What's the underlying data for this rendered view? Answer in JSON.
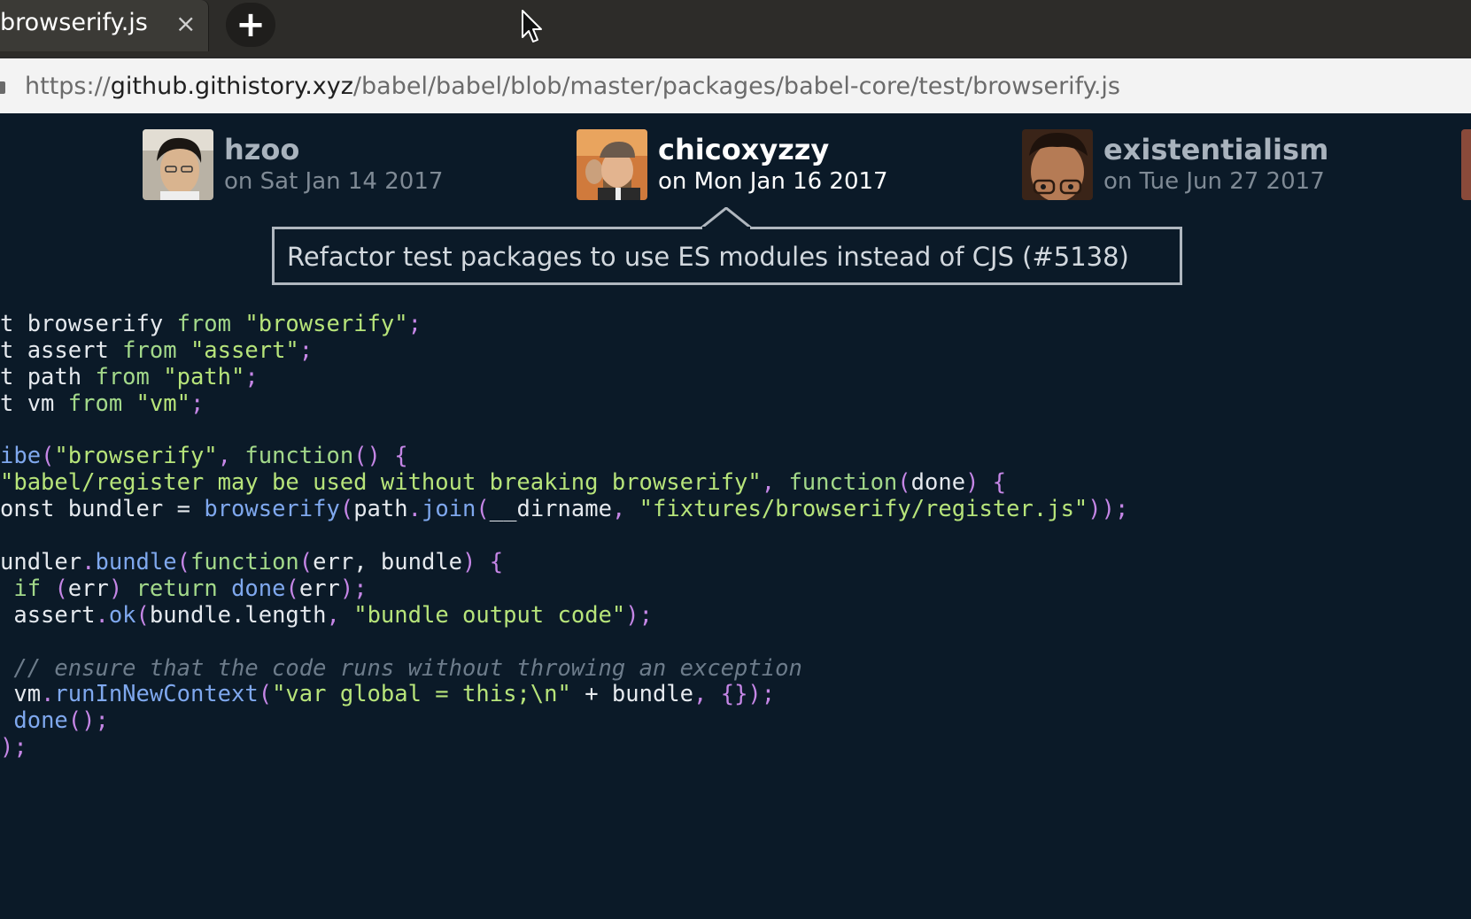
{
  "tab": {
    "title": "browserify.js",
    "close": "×",
    "new_tab": "+"
  },
  "url": {
    "scheme": "https://",
    "host": "github.githistory.xyz",
    "path": "/babel/babel/blob/master/packages/babel-core/test/browserify.js"
  },
  "commits": [
    {
      "author": "hzoo",
      "date": "on Sat Jan 14 2017"
    },
    {
      "author": "chicoxyzzy",
      "date": "on Mon Jan 16 2017"
    },
    {
      "author": "existentialism",
      "date": "on Tue Jun 27 2017"
    }
  ],
  "commit_message": "Refactor test packages to use ES modules instead of CJS (#5138)",
  "code": [
    [
      "t browserify ",
      "from",
      " ",
      "\"browserify\"",
      ";"
    ],
    [
      "t assert ",
      "from",
      " ",
      "\"assert\"",
      ";"
    ],
    [
      "t path ",
      "from",
      " ",
      "\"path\"",
      ";"
    ],
    [
      "t vm ",
      "from",
      " ",
      "\"vm\"",
      ";"
    ],
    [],
    [
      "ibe",
      "(",
      "\"browserify\"",
      ", ",
      "function",
      "() {"
    ],
    [
      "\"babel/register may be used without breaking browserify\"",
      ", ",
      "function",
      "(",
      "done",
      ") {"
    ],
    [
      "onst bundler ",
      "=",
      " ",
      "browserify",
      "(",
      "path",
      ".",
      "join",
      "(",
      "__dirname",
      ", ",
      "\"fixtures/browserify/register.js\"",
      "));"
    ],
    [],
    [
      "undler",
      ".",
      "bundle",
      "(",
      "function",
      "(",
      "err, bundle",
      ") {"
    ],
    [
      " ",
      "if",
      " ",
      "(",
      "err",
      ")",
      " ",
      "return",
      " ",
      "done",
      "(",
      "err",
      ");"
    ],
    [
      " assert",
      ".",
      "ok",
      "(",
      "bundle.length",
      ", ",
      "\"bundle output code\"",
      ");"
    ],
    [],
    [
      " ",
      "// ensure that the code runs without throwing an exception"
    ],
    [
      " vm",
      ".",
      "runInNewContext",
      "(",
      "\"var global = this;\\n\"",
      " + bundle",
      ", {});"
    ],
    [
      " ",
      "done",
      "();"
    ],
    [
      ");"
    ]
  ],
  "code_classes": [
    [
      "pl",
      "kw",
      "pl",
      "str",
      "pun"
    ],
    [
      "pl",
      "kw",
      "pl",
      "str",
      "pun"
    ],
    [
      "pl",
      "kw",
      "pl",
      "str",
      "pun"
    ],
    [
      "pl",
      "kw",
      "pl",
      "str",
      "pun"
    ],
    [],
    [
      "fn",
      "pun",
      "str",
      "pun",
      "kw",
      "pun"
    ],
    [
      "str",
      "pun",
      "kw",
      "pun",
      "pl",
      "pun"
    ],
    [
      "pl",
      "pl",
      "pl",
      "fn",
      "pun",
      "pl",
      "pun",
      "fn",
      "pun",
      "pl",
      "pun",
      "str",
      "pun"
    ],
    [],
    [
      "pl",
      "pun",
      "fn",
      "pun",
      "kw",
      "pun",
      "pl",
      "pun"
    ],
    [
      "pl",
      "kw",
      "pl",
      "pun",
      "pl",
      "pun",
      "pl",
      "kw",
      "pl",
      "fn",
      "pun",
      "pl",
      "pun"
    ],
    [
      "pl",
      "pun",
      "fn",
      "pun",
      "pl",
      "pun",
      "str",
      "pun"
    ],
    [],
    [
      "pl",
      "cm"
    ],
    [
      "pl",
      "pun",
      "fn",
      "pun",
      "str",
      "pl",
      "pun"
    ],
    [
      "pl",
      "fn",
      "pun"
    ],
    [
      "pun"
    ]
  ]
}
